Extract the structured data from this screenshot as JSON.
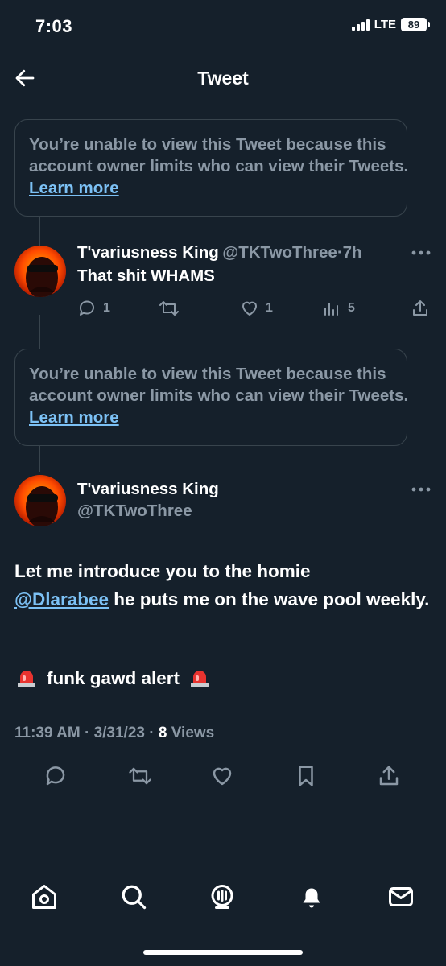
{
  "status_bar": {
    "time": "7:03",
    "network": "LTE",
    "battery": "89"
  },
  "header": {
    "title": "Tweet",
    "back_icon": "arrow-left-icon"
  },
  "notice_1": {
    "text": "You’re unable to view this Tweet because this account owner limits who can view their Tweets.",
    "link": "Learn more"
  },
  "reply_tweet": {
    "name": "T'variusness King",
    "handle": "@TKTwoThree",
    "separator": "·",
    "time": "7h",
    "text": "That shit WHAMS",
    "replies": "1",
    "likes": "1",
    "views": "5"
  },
  "notice_2": {
    "text": "You’re unable to view this Tweet because this account owner limits who can view their Tweets.",
    "link": "Learn more"
  },
  "main_tweet": {
    "name": "T'variusness King",
    "handle": "@TKTwoThree",
    "text_before": "Let me introduce you to the homie",
    "mention": "@Dlarabee",
    "text_after": " he puts me on the wave pool weekly.",
    "alert_text": "funk gawd alert",
    "time": "11:39 AM",
    "date": "3/31/23",
    "views_count": "8",
    "views_label": "Views",
    "meta_separator": "·"
  },
  "tab_bar": [
    "home-icon",
    "search-icon",
    "spaces-icon",
    "notifications-icon",
    "messages-icon"
  ],
  "colors": {
    "background": "#15202b",
    "muted": "#8b98a5",
    "link": "#7cc1f5",
    "border": "#38444d"
  }
}
